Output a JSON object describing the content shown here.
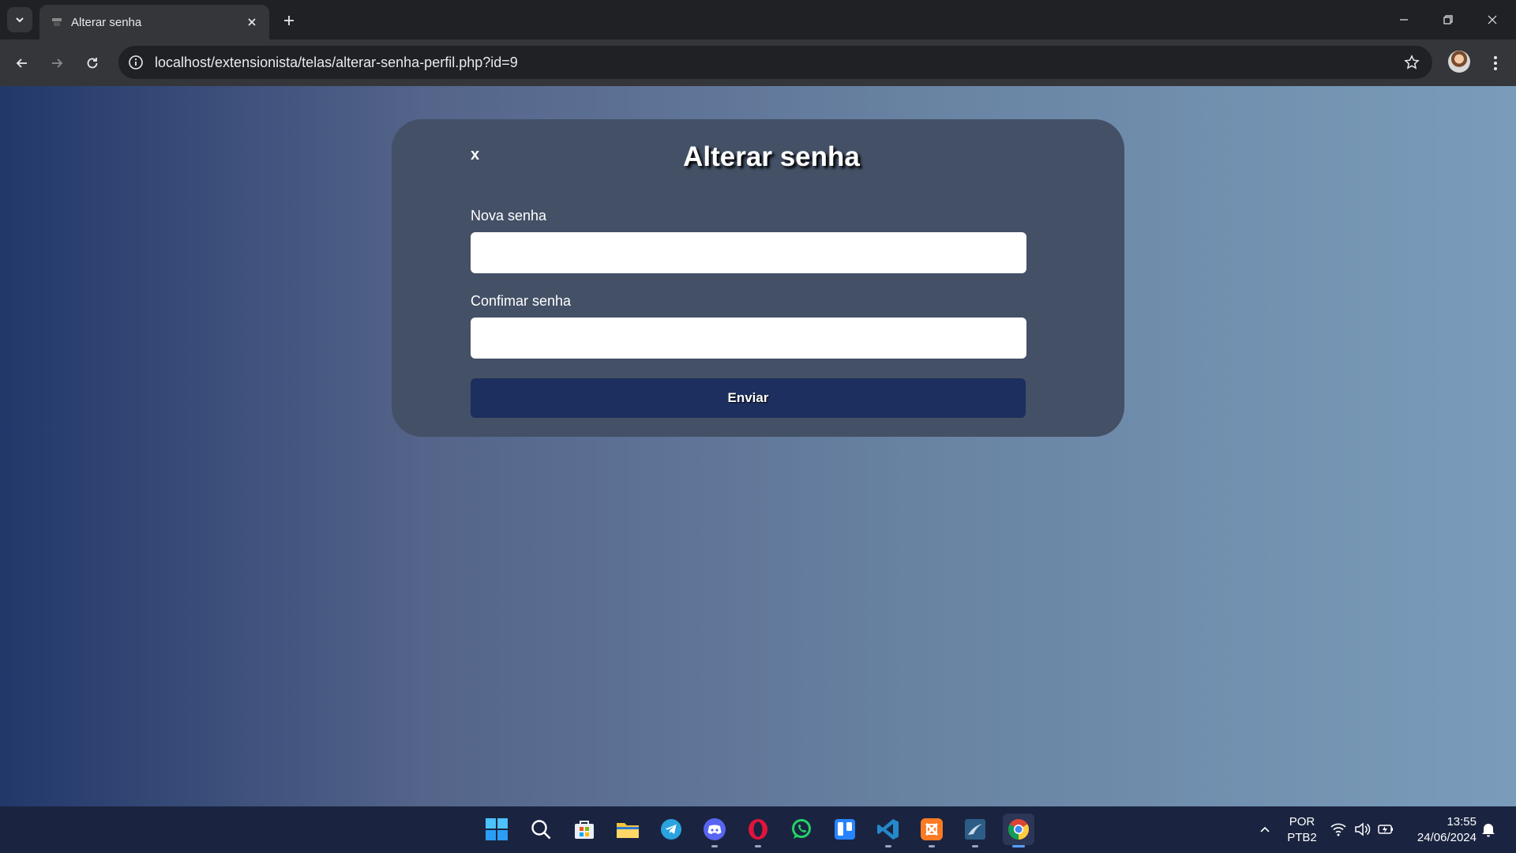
{
  "browser": {
    "tab_title": "Alterar senha",
    "url": "localhost/extensionista/telas/alterar-senha-perfil.php?id=9"
  },
  "page": {
    "close_label": "x",
    "title": "Alterar senha",
    "new_password_label": "Nova senha",
    "new_password_value": "",
    "confirm_password_label": "Confimar senha",
    "confirm_password_value": "",
    "submit_label": "Enviar"
  },
  "taskbar": {
    "apps": [
      "windows-start",
      "search",
      "microsoft-store",
      "file-explorer",
      "telegram",
      "discord",
      "opera",
      "whatsapp",
      "trello",
      "vscode",
      "xampp",
      "mysql-workbench",
      "chrome"
    ],
    "language_line1": "POR",
    "language_line2": "PTB2",
    "time": "13:55",
    "date": "24/06/2024"
  },
  "colors": {
    "card_bg": "#435066",
    "button_bg": "#1c2f5e",
    "gradient_start": "#22386a",
    "gradient_end": "#7a9cba"
  }
}
